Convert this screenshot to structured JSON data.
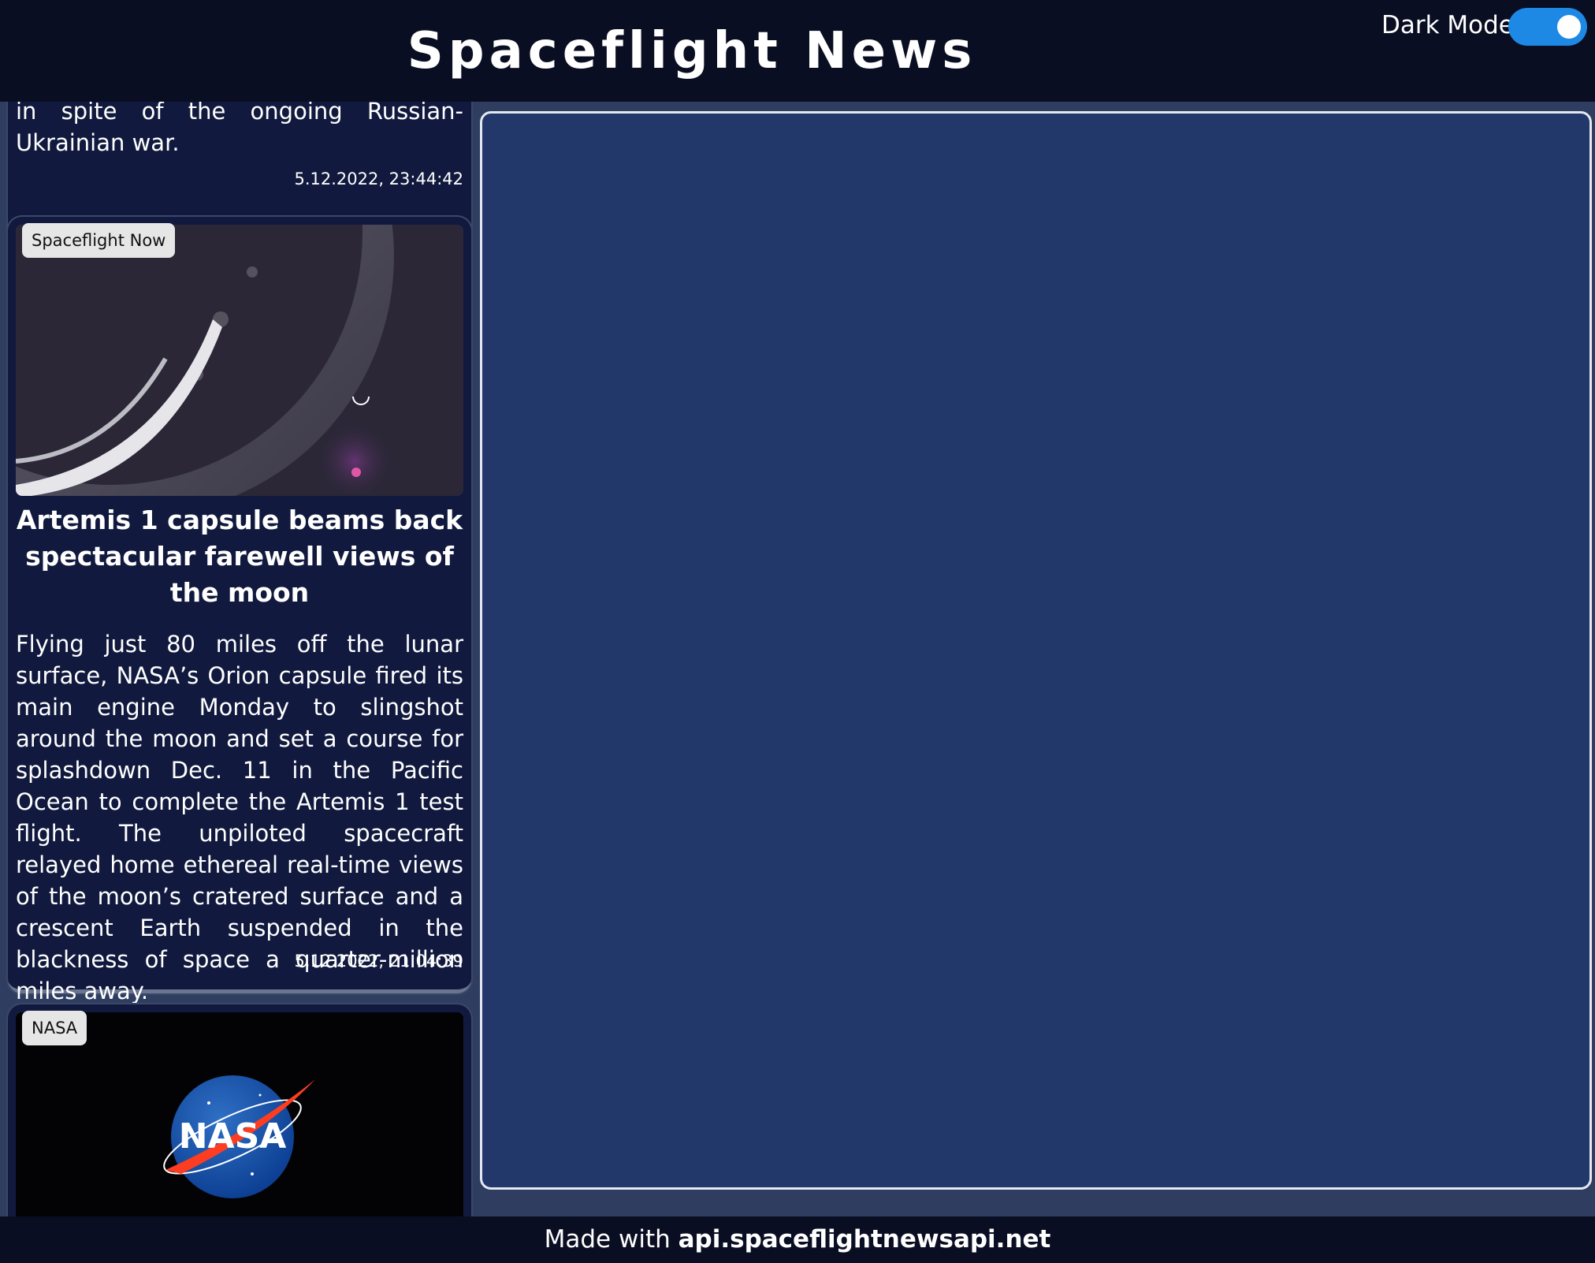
{
  "header": {
    "title": "Spaceflight News",
    "dark_mode_label": "Dark Mode",
    "dark_mode_on": true,
    "toggle_color": "#1e88e5"
  },
  "articles": [
    {
      "summary_tail": "in spite of the ongoing Russian-Ukrainian war.",
      "date": "5.12.2022, 23:44:42"
    },
    {
      "source": "Spaceflight Now",
      "title": "Artemis 1 capsule beams back spectacular farewell views of the moon",
      "summary": "Flying just 80 miles off the lunar surface, NASA’s Orion capsule fired its main engine Monday to slingshot around the moon and set a course for splashdown Dec. 11 in the Pacific Ocean to complete the Artemis 1 test flight. The unpiloted spacecraft relayed home ethereal real-time views of the moon’s cratered surface and a crescent Earth suspended in the blackness of space a quarter-million miles away.",
      "date": "5.12.2022, 21:04:39",
      "image": "moon-earth-crescent-photo"
    },
    {
      "source": "NASA",
      "image": "nasa-meatball-logo",
      "logo_text": "NASA"
    }
  ],
  "footer": {
    "prefix": "Made with ",
    "link": "api.spaceflightnewsapi.net"
  },
  "colors": {
    "header_bg": "#0a0e22",
    "card_bg": "#111a3e",
    "panel_bg": "#22376a",
    "page_bg": "#2e3d60"
  }
}
